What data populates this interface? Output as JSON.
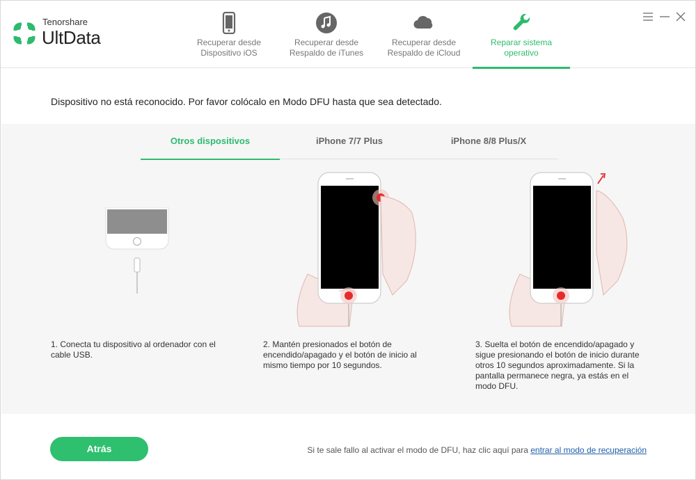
{
  "app": {
    "brand_small": "Tenorshare",
    "brand_name": "UltData",
    "accent_color": "#2dbb6e"
  },
  "nav": {
    "tabs": [
      {
        "label_line1": "Recuperar desde",
        "label_line2": "Dispositivo iOS",
        "icon": "phone-icon",
        "active": false
      },
      {
        "label_line1": "Recuperar desde",
        "label_line2": "Respaldo de iTunes",
        "icon": "music-note-icon",
        "active": false
      },
      {
        "label_line1": "Recuperar desde",
        "label_line2": "Respaldo de iCloud",
        "icon": "cloud-icon",
        "active": false
      },
      {
        "label_line1": "Reparar sistema",
        "label_line2": "operativo",
        "icon": "wrench-icon",
        "active": true
      }
    ]
  },
  "window_controls": [
    "menu-icon",
    "minimize-icon",
    "close-icon"
  ],
  "message": "Dispositivo no está reconocido. Por favor colócalo en Modo DFU hasta que sea detectado.",
  "device_tabs": [
    {
      "label": "Otros dispositivos",
      "active": true
    },
    {
      "label": "iPhone 7/7 Plus",
      "active": false
    },
    {
      "label": "iPhone 8/8 Plus/X",
      "active": false
    }
  ],
  "steps": [
    {
      "text": "1. Conecta tu dispositivo al ordenador con el cable USB."
    },
    {
      "text": "2. Mantén presionados el botón de encendido/apagado y el botón de inicio al mismo tiempo por 10 segundos."
    },
    {
      "text": "3. Suelta el botón de encendido/apagado y sigue presionando el botón de inicio durante otros 10 segundos aproximadamente. Si la pantalla permanece negra, ya estás en el modo DFU."
    }
  ],
  "footer": {
    "back_label": "Atrás",
    "note_text": "Si te sale fallo al activar el modo de DFU, haz clic aquí para",
    "link_text": "entrar al modo de recuperación"
  }
}
